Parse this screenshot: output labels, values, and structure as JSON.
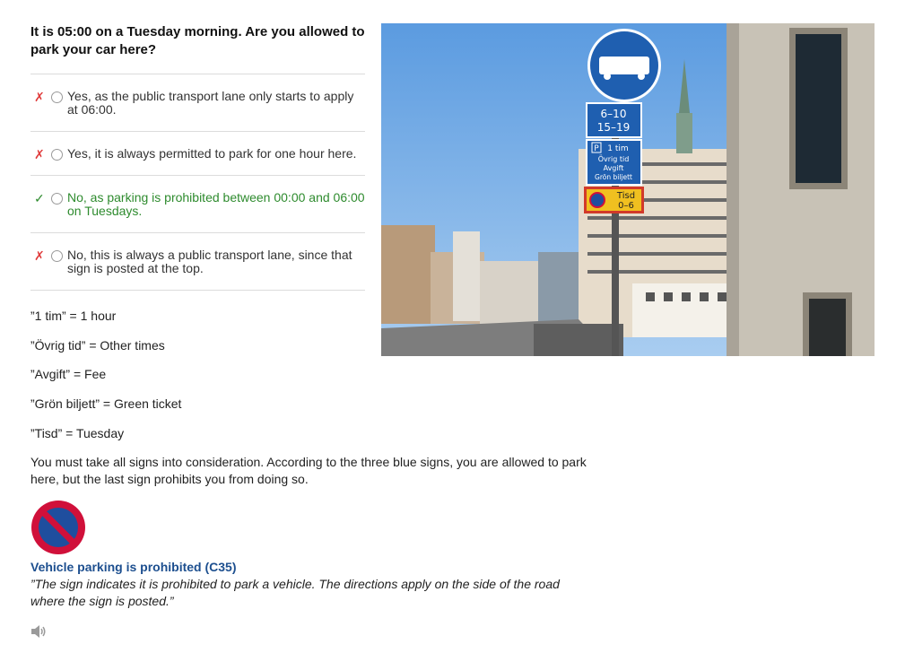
{
  "question": "It is 05:00 on a Tuesday morning. Are you allowed to park your car here?",
  "answers": [
    {
      "mark": "✗",
      "status": "wrong",
      "text": "Yes, as the public transport lane only starts to apply at 06:00."
    },
    {
      "mark": "✗",
      "status": "wrong",
      "text": "Yes, it is always permitted to park for one hour here."
    },
    {
      "mark": "✓",
      "status": "correct",
      "text": "No, as parking is prohibited between 00:00 and 06:00 on Tuesdays."
    },
    {
      "mark": "✗",
      "status": "wrong",
      "text": "No, this is always a public transport lane, since that sign is posted at the top."
    }
  ],
  "photo": {
    "sign_times_1": "6–10",
    "sign_times_2": "15–19",
    "sign_p_line1": "1 tim",
    "sign_p_line2": "Övrig tid",
    "sign_p_line3": "Avgift",
    "sign_p_line4": "Grön biljett",
    "sign_p_letter": "P",
    "sign_tisd_line1": "Tisd",
    "sign_tisd_line2": "0–6"
  },
  "glossary": [
    "”1 tim” = 1 hour",
    "”Övrig tid” = Other times",
    "”Avgift” = Fee",
    "”Grön biljett” = Green ticket",
    "”Tisd” = Tuesday"
  ],
  "explanation": "You must take all signs into consideration. According to the three blue signs, you are allowed to park here, but the last sign prohibits you from doing so.",
  "sign": {
    "title": "Vehicle parking is prohibited (C35)",
    "quote": "”The sign indicates it is prohibited to park a vehicle. The directions apply on the side of the road where the sign is posted.”",
    "icon": "no-parking-sign-icon"
  },
  "audio_icon": "speaker-icon",
  "colors": {
    "correct": "#2e8b2e",
    "wrong": "#e03b3b",
    "sign_title": "#1d4f8f",
    "sign_red": "#d0103a",
    "sign_blue": "#1f4e9e"
  }
}
